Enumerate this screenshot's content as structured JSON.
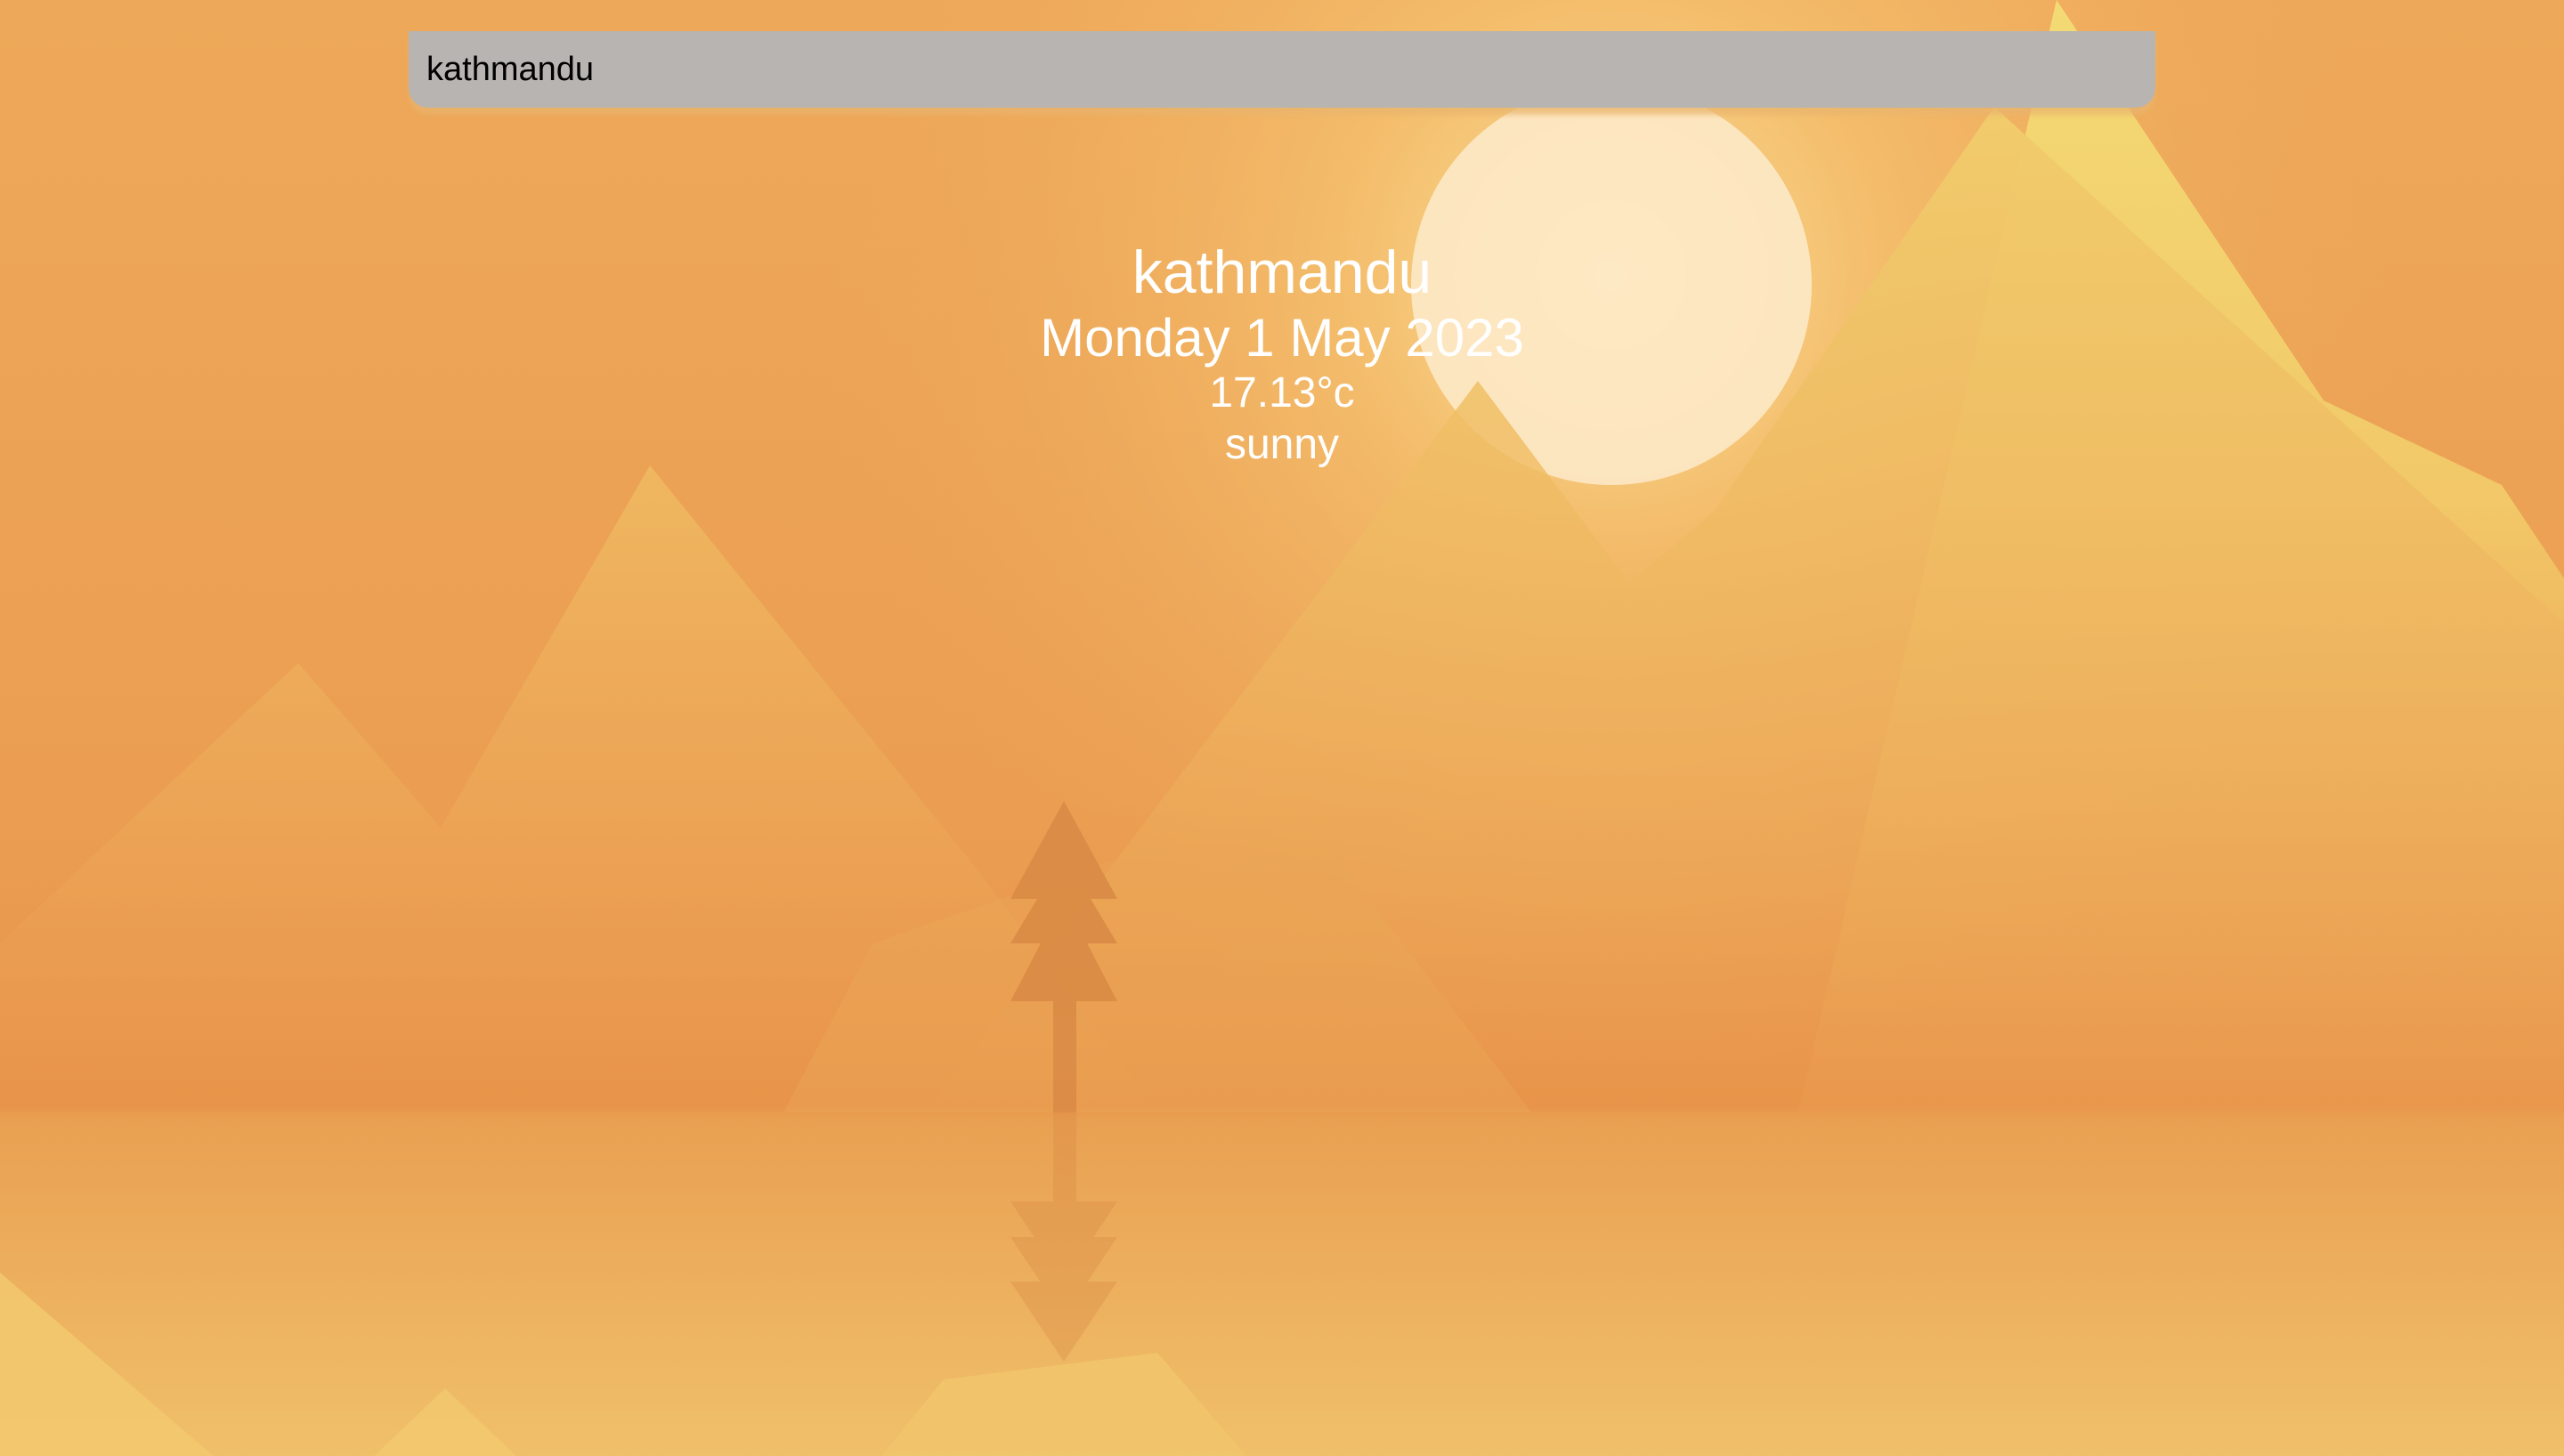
{
  "search": {
    "value": "kathmandu",
    "placeholder": ""
  },
  "weather": {
    "city": "kathmandu",
    "date": "Monday 1 May 2023",
    "temperature": "17.13°c",
    "condition": "sunny"
  },
  "background": {
    "theme": "sunny-mountain-landscape",
    "sky_color": "#eda558",
    "sun_color": "#fde9c6",
    "mountain_color": "#f2d36f",
    "tree_color": "#d98a45"
  }
}
